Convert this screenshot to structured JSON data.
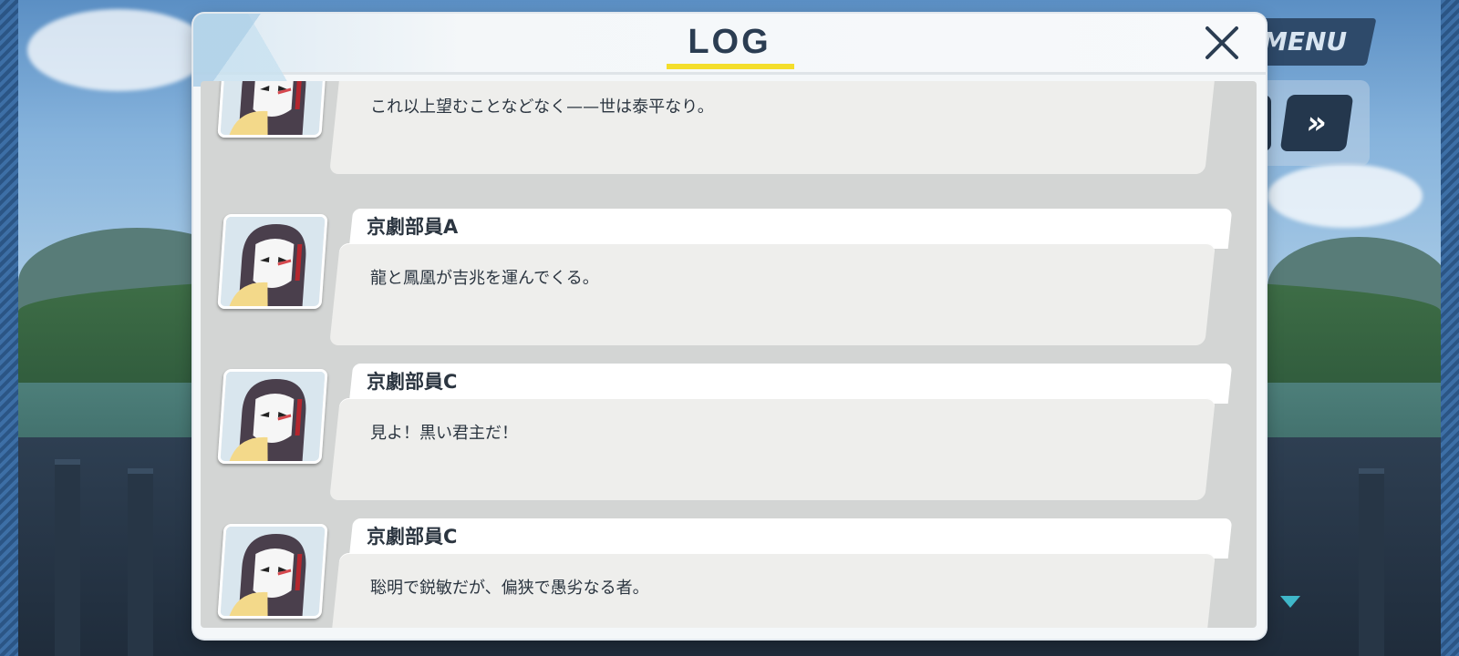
{
  "hud": {
    "menu_label": "MENU",
    "fast_forward_glyph": "»",
    "colors": {
      "hud_dark": "#24374d",
      "accent_yellow": "#f4de2b",
      "indicator_cyan": "#3fb7c9"
    }
  },
  "log": {
    "title": "LOG",
    "close_glyph": "×",
    "entries": [
      {
        "speaker": "",
        "text": "これ以上望むことなどなく——世は泰平なり。",
        "avatar_icon": "masked-performer-portrait"
      },
      {
        "speaker": "京劇部員A",
        "text": "龍と鳳凰が吉兆を運んでくる。",
        "avatar_icon": "masked-performer-portrait"
      },
      {
        "speaker": "京劇部員C",
        "text": "見よ！黒い君主だ！",
        "avatar_icon": "masked-performer-portrait"
      },
      {
        "speaker": "京劇部員C",
        "text": "聡明で鋭敏だが、偏狭で愚劣なる者。",
        "avatar_icon": "masked-performer-portrait"
      }
    ]
  }
}
